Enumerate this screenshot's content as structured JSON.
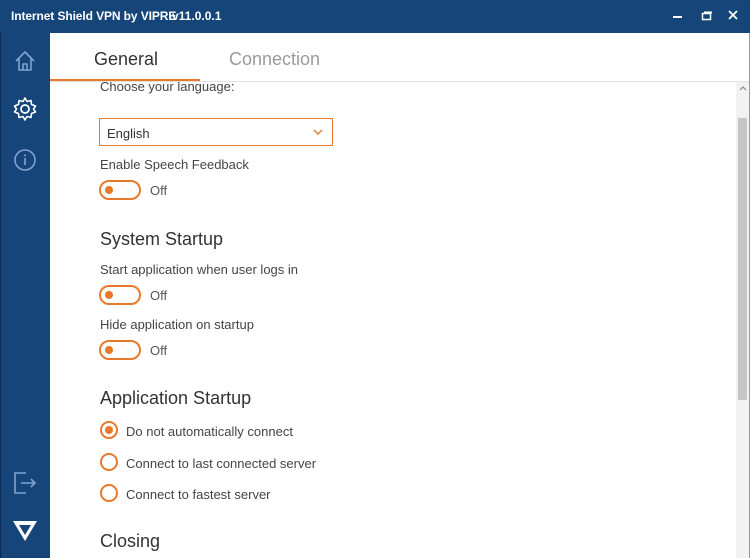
{
  "window": {
    "title": "Internet Shield VPN by VIPRE",
    "version": "v11.0.0.1"
  },
  "sidebar": {
    "items": [
      {
        "icon": "home-icon"
      },
      {
        "icon": "gear-icon"
      },
      {
        "icon": "info-icon"
      },
      {
        "icon": "logout-icon"
      },
      {
        "icon": "vipre-logo"
      }
    ]
  },
  "tabs": {
    "general": "General",
    "connection": "Connection"
  },
  "language": {
    "label": "Choose your language:",
    "selected": "English"
  },
  "speech": {
    "label": "Enable Speech Feedback",
    "state": "Off"
  },
  "system_startup": {
    "heading": "System Startup",
    "start_label": "Start application when user logs in",
    "start_state": "Off",
    "hide_label": "Hide application on startup",
    "hide_state": "Off"
  },
  "application_startup": {
    "heading": "Application Startup",
    "options": [
      {
        "label": "Do not automatically connect",
        "selected": true
      },
      {
        "label": "Connect to last connected server",
        "selected": false
      },
      {
        "label": "Connect to fastest server",
        "selected": false
      }
    ]
  },
  "closing": {
    "heading": "Closing"
  },
  "colors": {
    "brand": "#16457a",
    "accent": "#e8792b"
  }
}
